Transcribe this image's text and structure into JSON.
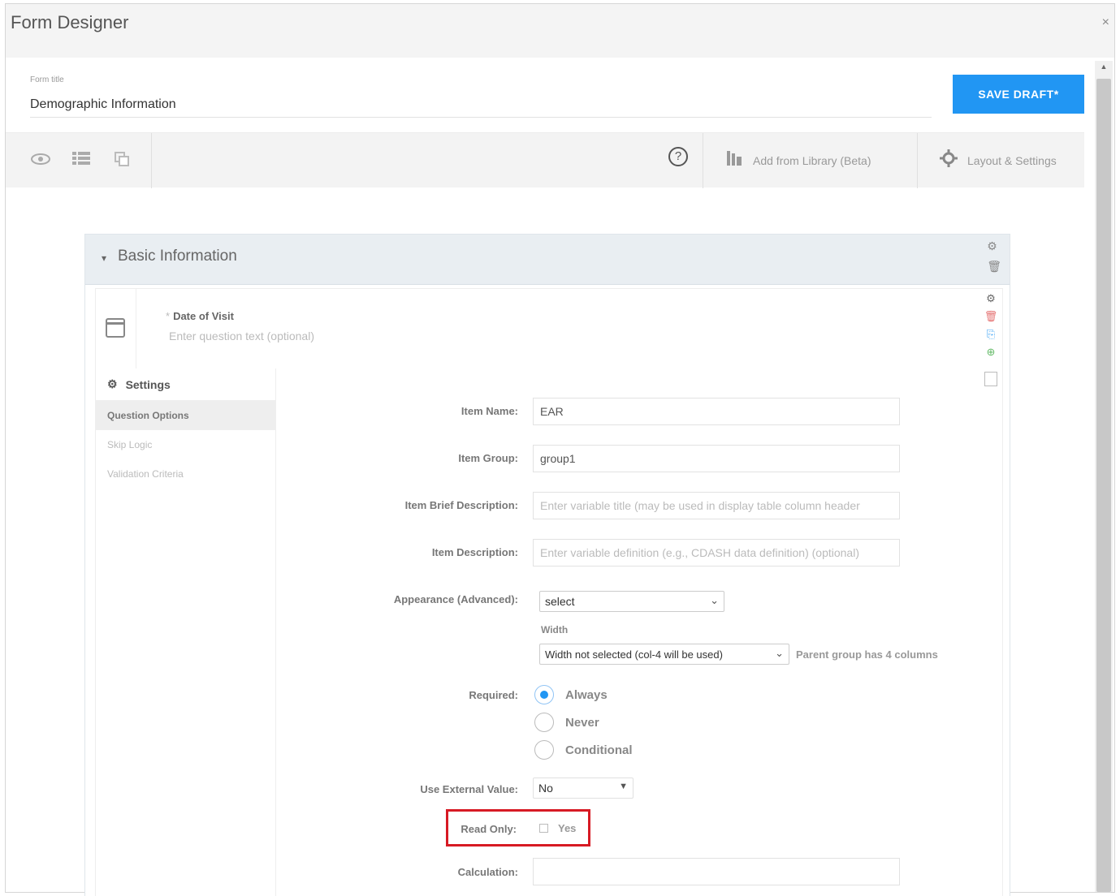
{
  "window": {
    "title": "Form Designer",
    "close": "×"
  },
  "header": {
    "form_title_label": "Form title",
    "form_title_value": "Demographic Information",
    "save_label": "SAVE DRAFT*"
  },
  "toolbar": {
    "help": "?",
    "add_from_library": "Add from Library (Beta)",
    "layout_settings": "Layout & Settings"
  },
  "section": {
    "title": "Basic Information",
    "caret": "▾"
  },
  "question": {
    "label": "Date of Visit",
    "required_marker": "*",
    "description_placeholder": "Enter question text (optional)"
  },
  "settings": {
    "title": "Settings",
    "nav": [
      "Question Options",
      "Skip Logic",
      "Validation Criteria"
    ]
  },
  "fields": {
    "item_name": {
      "label": "Item Name:",
      "value": "EAR"
    },
    "item_group": {
      "label": "Item Group:",
      "value": "group1"
    },
    "item_brief_description": {
      "label": "Item Brief Description:",
      "placeholder": "Enter variable title (may be used in display table column header"
    },
    "item_description": {
      "label": "Item Description:",
      "placeholder": "Enter variable definition (e.g., CDASH data definition) (optional)"
    },
    "appearance": {
      "label": "Appearance (Advanced):",
      "value": "select",
      "width_label": "Width",
      "width_value": "Width not selected (col-4 will be used)",
      "width_hint": "Parent group has 4 columns"
    },
    "required": {
      "label": "Required:",
      "options": [
        "Always",
        "Never",
        "Conditional"
      ],
      "selected": "Always"
    },
    "use_external_value": {
      "label": "Use External Value:",
      "value": "No"
    },
    "read_only": {
      "label": "Read Only:",
      "option": "Yes",
      "checked": false
    },
    "calculation": {
      "label": "Calculation:",
      "value": ""
    }
  },
  "colors": {
    "accent": "#2196f3",
    "highlight": "#d71a24"
  }
}
